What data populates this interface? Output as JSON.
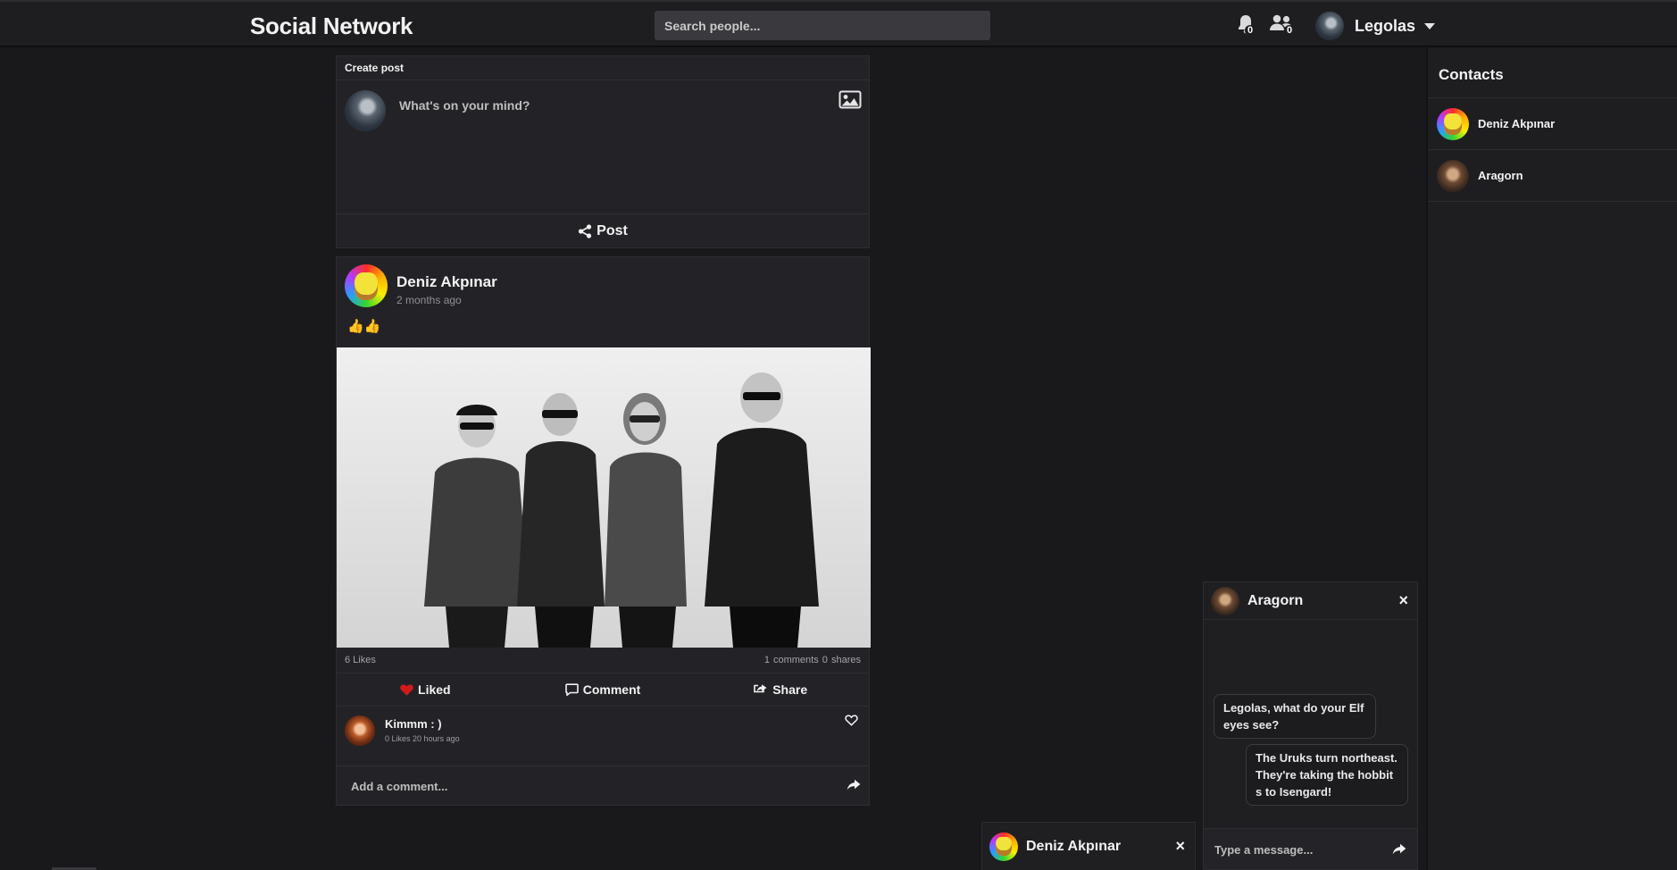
{
  "navbar": {
    "brand": "Social Network",
    "search_placeholder": "Search people...",
    "notifications_count": "0",
    "friend_requests_count": "0",
    "username": "Legolas"
  },
  "create_post": {
    "header": "Create post",
    "placeholder": "What's on your mind?",
    "post_label": "Post"
  },
  "post": {
    "author": "Deniz Akpınar",
    "time": "2 months ago",
    "text": "👍👍",
    "likes": "6 Likes",
    "comments": "1 comments",
    "shares": "0 shares",
    "liked_label": "Liked",
    "comment_label": "Comment",
    "share_label": "Share",
    "comment": {
      "author": "Kimmm : )",
      "likes": "0 Likes",
      "time": "20 hours ago"
    },
    "add_comment_placeholder": "Add a comment..."
  },
  "contacts": {
    "title": "Contacts",
    "items": [
      {
        "name": "Deniz Akpınar"
      },
      {
        "name": "Aragorn"
      }
    ]
  },
  "chat": {
    "title": "Aragorn",
    "close": "×",
    "messages": [
      {
        "text": "Legolas, what do your Elf eyes see?",
        "side": "left"
      },
      {
        "text": "The Uruks turn northeast. They're taking the hobbits to Isengard!",
        "side": "right"
      }
    ],
    "input_placeholder": "Type a message..."
  },
  "mini_chat": {
    "title": "Deniz Akpınar",
    "close": "×"
  },
  "colors": {
    "background": "#19191c",
    "card": "#232327",
    "liked_heart": "#d11a1a"
  }
}
